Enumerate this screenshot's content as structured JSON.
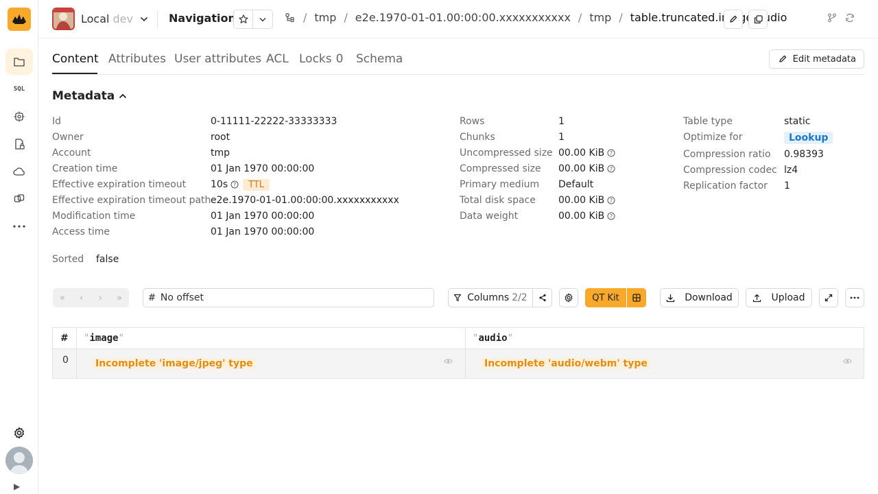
{
  "header": {
    "cluster_name": "Local",
    "cluster_env": "dev",
    "page_title": "Navigation",
    "breadcrumbs": [
      "tmp",
      "e2e.1970-01-01.00:00:00.xxxxxxxxxxx",
      "tmp",
      "table.truncated.image-audio"
    ]
  },
  "tabs": [
    {
      "label": "Content"
    },
    {
      "label": "Attributes"
    },
    {
      "label": "User attributes"
    },
    {
      "label": "ACL"
    },
    {
      "label": "Locks",
      "count": "0"
    },
    {
      "label": "Schema"
    }
  ],
  "edit_metadata_label": "Edit metadata",
  "metadata": {
    "title": "Metadata",
    "col1": [
      {
        "key": "Id",
        "value": "0-11111-22222-33333333"
      },
      {
        "key": "Owner",
        "value": "root"
      },
      {
        "key": "Account",
        "value": "tmp"
      },
      {
        "key": "Creation time",
        "value": "01 Jan 1970 00:00:00"
      },
      {
        "key": "Effective expiration timeout",
        "value": "10s",
        "badge": "TTL"
      },
      {
        "key": "Effective expiration timeout path",
        "value": "e2e.1970-01-01.00:00:00.xxxxxxxxxxx"
      },
      {
        "key": "Modification time",
        "value": "01 Jan 1970 00:00:00"
      },
      {
        "key": "Access time",
        "value": "01 Jan 1970 00:00:00"
      }
    ],
    "col2": [
      {
        "key": "Rows",
        "value": "1"
      },
      {
        "key": "Chunks",
        "value": "1"
      },
      {
        "key": "Uncompressed size",
        "value": "00.00 KiB"
      },
      {
        "key": "Compressed size",
        "value": "00.00 KiB"
      },
      {
        "key": "Primary medium",
        "value": "Default"
      },
      {
        "key": "Total disk space",
        "value": "00.00 KiB"
      },
      {
        "key": "Data weight",
        "value": "00.00 KiB"
      }
    ],
    "col3": [
      {
        "key": "Table type",
        "value": "static"
      },
      {
        "key": "Optimize for",
        "value": "Lookup"
      },
      {
        "key": "Compression ratio",
        "value": "0.98393"
      },
      {
        "key": "Compression codec",
        "value": "lz4"
      },
      {
        "key": "Replication factor",
        "value": "1"
      }
    ],
    "sorted": {
      "key": "Sorted",
      "value": "false"
    }
  },
  "toolbar": {
    "offset_value": "No offset",
    "columns_label": "Columns",
    "columns_count": "2/2",
    "qt_kit_label": "QT Kit",
    "download_label": "Download",
    "upload_label": "Upload"
  },
  "table": {
    "index_header": "#",
    "columns": [
      "image",
      "audio"
    ],
    "rows": [
      {
        "index": "0",
        "image": "Incomplete 'image/jpeg' type",
        "audio": "Incomplete 'audio/webm' type"
      }
    ]
  },
  "colors": {
    "accent": "#f8a92a",
    "ttl_text": "#d47a10",
    "lookup_text": "#1d78c9",
    "incomplete_text": "#e38d13"
  }
}
